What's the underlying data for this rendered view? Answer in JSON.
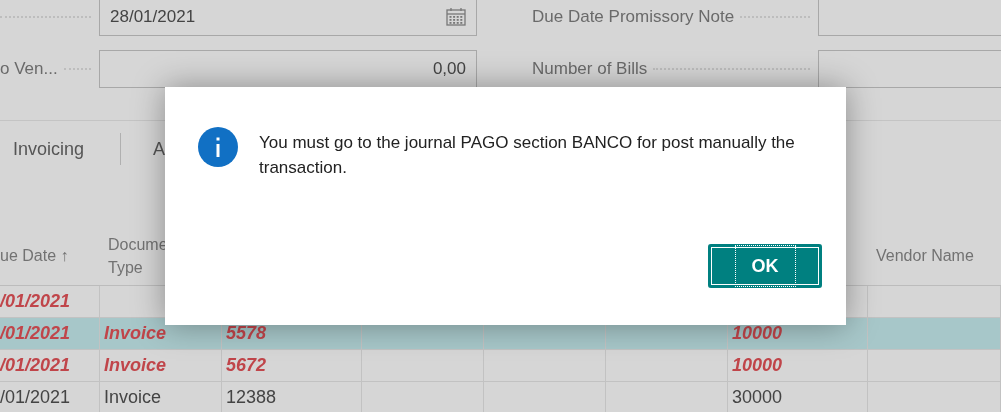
{
  "fields_left": [
    {
      "kind": "date",
      "value": "28/01/2021"
    },
    {
      "kind": "number",
      "label": "o Ven...",
      "value": "0,00"
    }
  ],
  "fields_right": [
    {
      "label": "Due Date Promissory Note"
    },
    {
      "label": "Number of Bills"
    }
  ],
  "actions": [
    {
      "label": "Invoicing"
    },
    {
      "label": "A"
    }
  ],
  "table": {
    "columns": [
      {
        "lines": [
          "ue Date ↑"
        ]
      },
      {
        "lines": [
          "Docume",
          "Type"
        ]
      },
      {},
      {},
      {},
      {},
      {},
      {
        "lines": [
          "Vendor Name"
        ]
      }
    ],
    "rows": [
      {
        "selected": false,
        "overdue": true,
        "cells": [
          "/01/2021",
          null,
          null,
          null,
          null,
          null,
          null,
          null
        ]
      },
      {
        "selected": true,
        "overdue": true,
        "cells": [
          "/01/2021",
          "Invoice",
          "5578",
          null,
          null,
          null,
          "10000",
          null
        ]
      },
      {
        "selected": false,
        "overdue": true,
        "cells": [
          "/01/2021",
          "Invoice",
          "5672",
          null,
          null,
          null,
          "10000",
          null
        ]
      },
      {
        "selected": false,
        "overdue": false,
        "cells": [
          "/01/2021",
          "Invoice",
          "12388",
          null,
          null,
          null,
          "30000",
          null
        ]
      }
    ]
  },
  "dialog": {
    "message": "You must go to the journal PAGO section BANCO for post manually the transaction.",
    "button": {
      "label": "OK",
      "focused": true
    }
  }
}
